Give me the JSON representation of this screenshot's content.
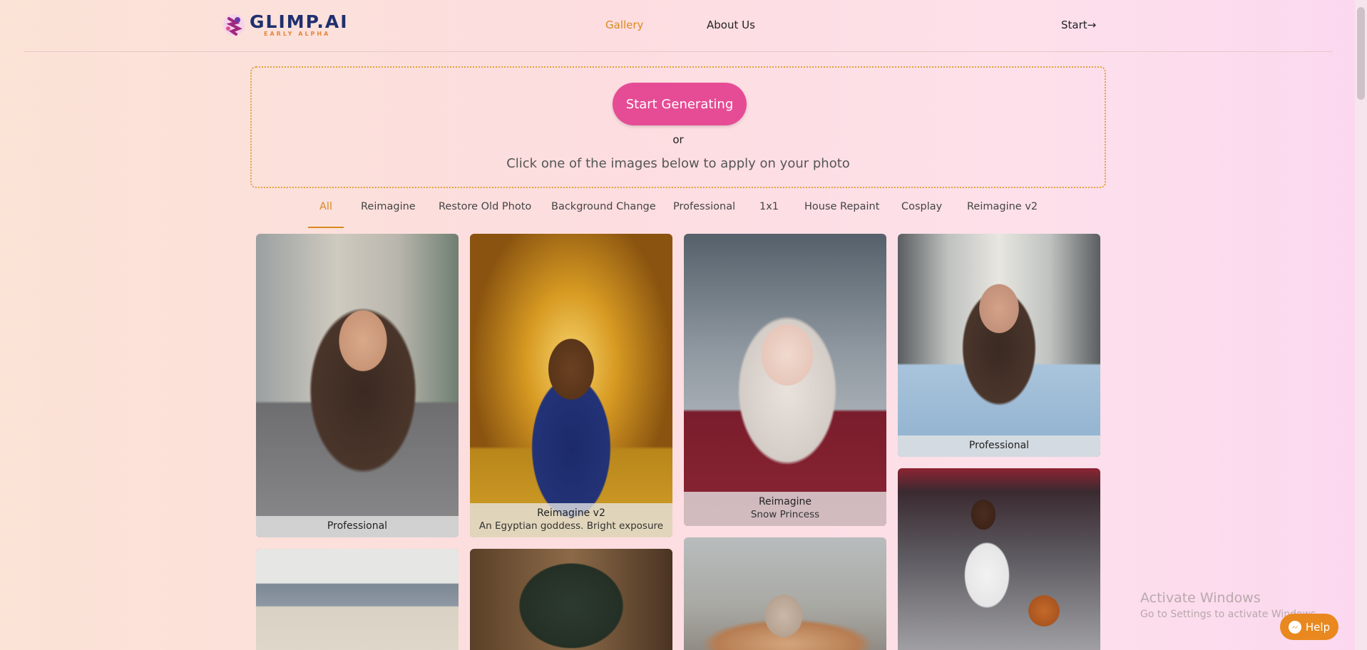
{
  "header": {
    "logo_title": "GLIMP.AI",
    "logo_subtitle": "EARLY ALPHA",
    "nav": [
      {
        "label": "Gallery",
        "active": true
      },
      {
        "label": "About Us",
        "active": false
      }
    ],
    "start_label": "Start→"
  },
  "generate": {
    "button_label": "Start Generating",
    "or_text": "or",
    "hint_text": "Click one of the images below to apply on your photo"
  },
  "tabs": [
    {
      "label": "All",
      "active": true
    },
    {
      "label": "Reimagine"
    },
    {
      "label": "Restore Old Photo"
    },
    {
      "label": "Background Change"
    },
    {
      "label": "Professional"
    },
    {
      "label": "1x1"
    },
    {
      "label": "House Repaint"
    },
    {
      "label": "Cosplay"
    },
    {
      "label": "Reimagine v2"
    }
  ],
  "gallery": [
    {
      "title": "Professional",
      "subtitle": ""
    },
    {
      "title": "Reimagine v2",
      "subtitle": "An Egyptian goddess. Bright exposure"
    },
    {
      "title": "Reimagine",
      "subtitle": "Snow Princess"
    },
    {
      "title": "Professional",
      "subtitle": ""
    }
  ],
  "watermark": {
    "line1": "Activate Windows",
    "line2": "Go to Settings to activate Windows."
  },
  "help_label": "Help",
  "colors": {
    "accent": "#d98a1f",
    "primary_button": "#e64c95",
    "help_button": "#e8881f"
  }
}
